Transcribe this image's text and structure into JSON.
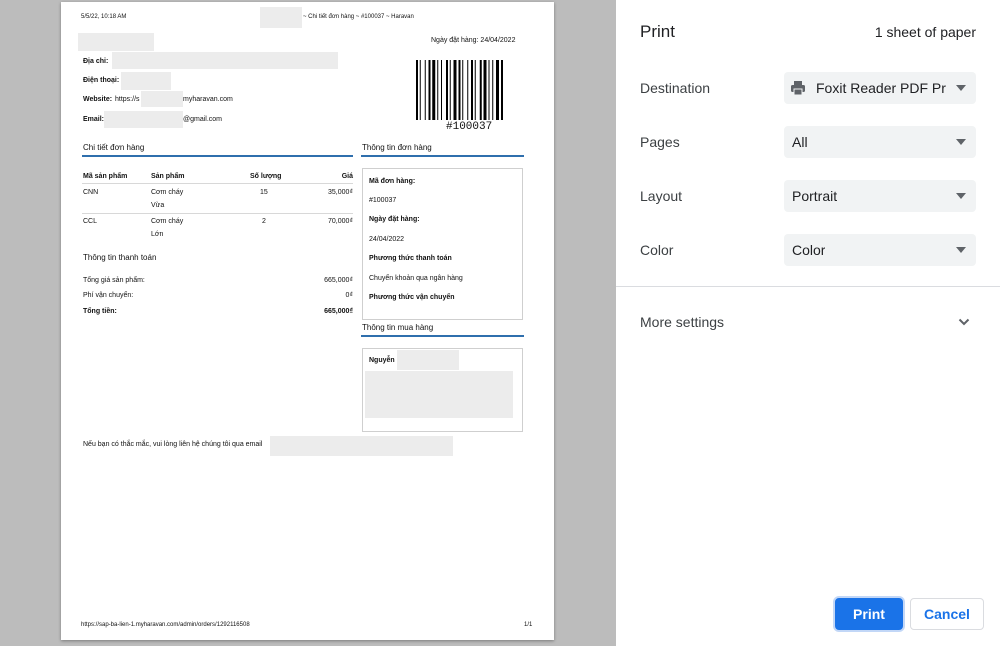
{
  "sheet": {
    "header_datetime": "5/5/22, 10:18 AM",
    "header_title": "~ Chi tiết đơn hàng ~ #100037 ~ Haravan",
    "order_date_label": "Ngày đặt hàng: 24/04/2022",
    "address_label": "Địa chỉ:",
    "phone_label": "Điện thoại:",
    "website_label": "Website:",
    "website_prefix": "https://s",
    "website_suffix": "myharavan.com",
    "email_label": "Email:",
    "email_suffix": "@gmail.com",
    "barcode_text": "#100037",
    "order_detail_title": "Chi tiết đơn hàng",
    "order_info_title": "Thông tin đơn hàng",
    "columns": [
      "Mã sản phẩm",
      "Sản phẩm",
      "Số lượng",
      "Giá"
    ],
    "rows": [
      {
        "code": "CNN",
        "product": "Cơm cháy",
        "variant": "Vừa",
        "qty": "15",
        "price": "35,000₫"
      },
      {
        "code": "CCL",
        "product": "Cơm cháy",
        "variant": "Lớn",
        "qty": "2",
        "price": "70,000₫"
      }
    ],
    "payment_title": "Thông tin thanh toán",
    "subtotal_label": "Tổng giá sản phẩm:",
    "subtotal_value": "665,000₫",
    "shipping_label": "Phí vận chuyển:",
    "shipping_value": "0₫",
    "total_label": "Tổng tiền:",
    "total_value": "665,000₫",
    "order_code_label": "Mã đơn hàng:",
    "order_code_value": "#100037",
    "order_date_field_label": "Ngày đặt hàng:",
    "order_date_value": "24/04/2022",
    "payment_method_label": "Phương thức thanh toán",
    "payment_method_value": "Chuyển khoản qua ngân hàng",
    "shipping_method_label": "Phương thức vận chuyển",
    "buyer_title": "Thông tin mua hàng",
    "buyer_name": "Nguyễn",
    "contact_note": "Nếu bạn có thắc mắc, vui lòng liên hệ chúng tôi qua email",
    "footer_url": "https://sap-ba-lien-1.myharavan.com/admin/orders/1292116508",
    "footer_page": "1/1"
  },
  "print": {
    "title": "Print",
    "sheet_count": "1 sheet of paper",
    "destination_label": "Destination",
    "destination_value": "Foxit Reader PDF Printer",
    "pages_label": "Pages",
    "pages_value": "All",
    "layout_label": "Layout",
    "layout_value": "Portrait",
    "color_label": "Color",
    "color_value": "Color",
    "more_settings_label": "More settings",
    "print_button": "Print",
    "cancel_button": "Cancel"
  },
  "colors": {
    "accent": "#1a73e8",
    "section_rule": "#2f6fad",
    "preview_bg": "#bcbcbc"
  }
}
